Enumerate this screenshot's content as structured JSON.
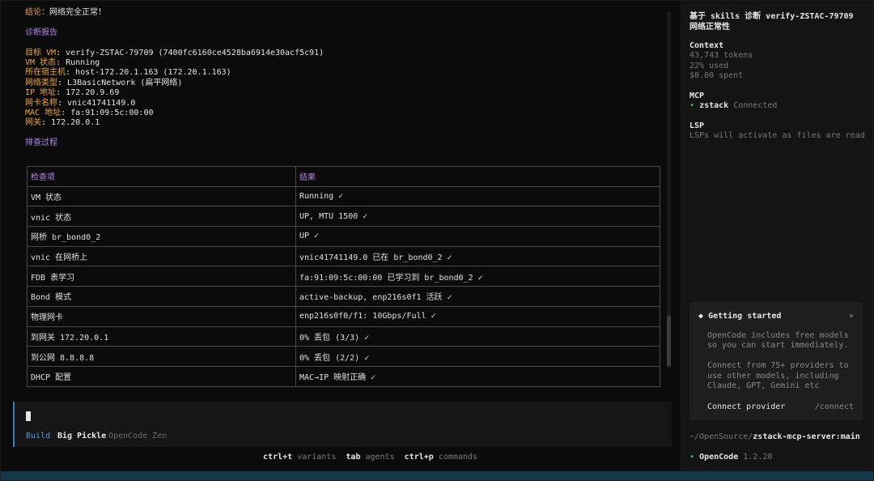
{
  "report": {
    "conclusion_label": "结论：",
    "conclusion_text": "网络完全正常！",
    "section_diag": "诊断报告",
    "fields": [
      {
        "label": "目标 VM",
        "value": "verify-ZSTAC-79709 (7400fc6160ce4528ba6914e30acf5c91)"
      },
      {
        "label": "VM 状态",
        "value": "Running"
      },
      {
        "label": "所在宿主机",
        "value": "host-172.20.1.163 (172.20.1.163)"
      },
      {
        "label": "网络类型",
        "value": "L3BasicNetwork (扁平网络)"
      },
      {
        "label": "IP 地址",
        "value": "172.20.9.69"
      },
      {
        "label": "网卡名称",
        "value": "vnic41741149.0"
      },
      {
        "label": "MAC 地址",
        "value": "fa:91:09:5c:00:00"
      },
      {
        "label": "网关",
        "value": "172.20.0.1"
      }
    ],
    "section_process": "排查过程"
  },
  "table": {
    "headers": [
      "检查项",
      "结果"
    ],
    "rows": [
      [
        "VM 状态",
        "Running ✓"
      ],
      [
        "vnic 状态",
        "UP, MTU 1500 ✓"
      ],
      [
        "网桥 br_bond0_2",
        "UP ✓"
      ],
      [
        "vnic 在网桥上",
        "vnic41741149.0 已在 br_bond0_2 ✓"
      ],
      [
        "FDB 表学习",
        "fa:91:09:5c:00:00 已学习到 br_bond0_2 ✓"
      ],
      [
        "Bond 模式",
        "active-backup, enp216s0f1 活跃 ✓"
      ],
      [
        "物理网卡",
        "enp216s0f0/f1: 10Gbps/Full ✓"
      ],
      [
        "到网关 172.20.0.1",
        "0% 丢包 (3/3) ✓"
      ],
      [
        "到公网 8.8.8.8",
        "0% 丢包 (2/2) ✓"
      ],
      [
        "DHCP 配置",
        "MAC→IP 映射正确 ✓"
      ]
    ]
  },
  "prompt": {
    "mode": "Build",
    "model": "Big Pickle",
    "provider": "OpenCode Zen"
  },
  "shortcuts": [
    {
      "key": "ctrl+t",
      "label": "variants"
    },
    {
      "key": "tab",
      "label": "agents"
    },
    {
      "key": "ctrl+p",
      "label": "commands"
    }
  ],
  "sidebar": {
    "title_line1": "基于 skills 诊断 verify-ZSTAC-79709",
    "title_line2": "网络正常性",
    "context_heading": "Context",
    "tokens": "43,743 tokens",
    "used": "22% used",
    "spent": "$0.00 spent",
    "mcp_heading": "MCP",
    "mcp_name": "zstack",
    "mcp_status": "Connected",
    "lsp_heading": "LSP",
    "lsp_text": "LSPs will activate as files are read",
    "card": {
      "title": "Getting started",
      "close": "×",
      "body1": "OpenCode includes free models\nso you can start immediately.",
      "body2": "Connect from 75+ providers to\nuse other models, including\nClaude, GPT, Gemini etc",
      "link": "Connect provider",
      "command": "/connect"
    },
    "path_prefix": "~/OpenSource/",
    "path_repo": "zstack-mcp-server:main",
    "app_name": "OpenCode",
    "app_version": "1.2.20"
  },
  "colors": {
    "accent_orange": "#f0a53a",
    "accent_purple": "#b486e8",
    "accent_blue": "#4b9ad6",
    "status_green": "#39c46f"
  }
}
